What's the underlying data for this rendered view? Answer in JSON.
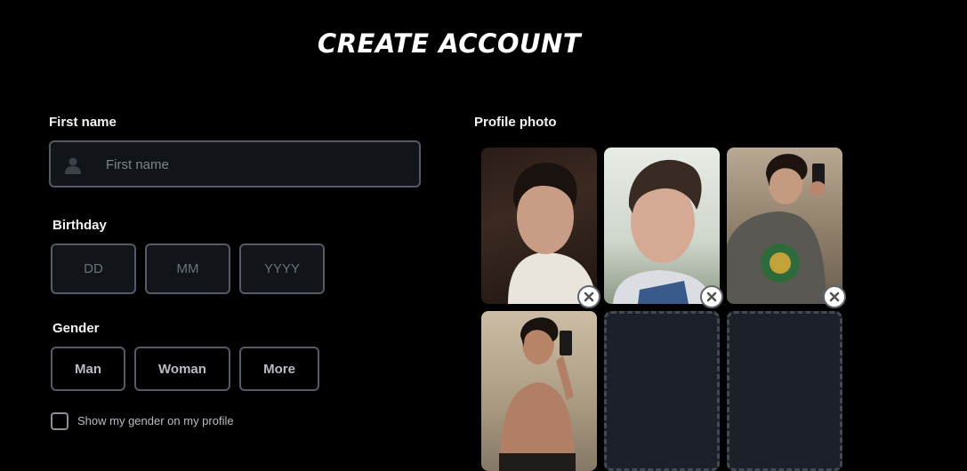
{
  "page": {
    "title": "CREATE ACCOUNT"
  },
  "first_name": {
    "label": "First name",
    "placeholder": "First name",
    "icon": "person-icon"
  },
  "birthday": {
    "label": "Birthday",
    "day_placeholder": "DD",
    "month_placeholder": "MM",
    "year_placeholder": "YYYY"
  },
  "gender": {
    "label": "Gender",
    "options": [
      "Man",
      "Woman",
      "More"
    ],
    "show_on_profile_label": "Show my gender on my profile",
    "show_on_profile_checked": false
  },
  "profile_photo": {
    "label": "Profile photo",
    "photos": [
      {
        "description_icon": "photo-thumbnail",
        "removable": true
      },
      {
        "description_icon": "photo-thumbnail",
        "removable": true
      },
      {
        "description_icon": "photo-thumbnail",
        "removable": true
      },
      {
        "description_icon": "photo-thumbnail",
        "removable": true
      }
    ],
    "empty_slots": 2
  },
  "colors": {
    "background": "#000000",
    "field_border": "#545a66",
    "field_background": "#111418",
    "empty_slot": "#1c2029"
  }
}
